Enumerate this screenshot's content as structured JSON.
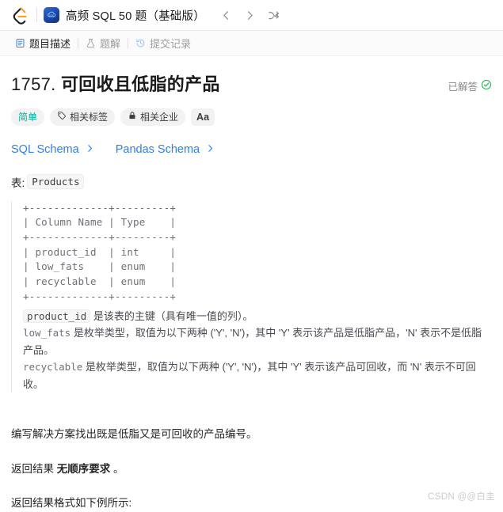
{
  "topbar": {
    "logo_icon": "leetcode-logo-icon",
    "app_icon": "study-plan-cloud-icon",
    "study_plan_title": "高频 SQL 50 题（基础版）",
    "prev_label": "‹",
    "next_label": "›",
    "shuffle_label": "⤫"
  },
  "tabs": [
    {
      "label": "题目描述",
      "icon": "description-icon",
      "active": true
    },
    {
      "label": "题解",
      "icon": "flask-icon",
      "active": false
    },
    {
      "label": "提交记录",
      "icon": "history-icon",
      "active": false
    }
  ],
  "question": {
    "number": "1757.",
    "title": "可回收且低脂的产品",
    "status_label": "已解答",
    "status_icon": "check-circle-icon",
    "difficulty": "简单",
    "difficulty_color": "#00af9b",
    "tags_label": "相关标签",
    "companies_label": "相关企业",
    "font_button_label": "Aa"
  },
  "schema_links": [
    {
      "label": "SQL Schema",
      "chevron": "›"
    },
    {
      "label": "Pandas Schema",
      "chevron": "›"
    }
  ],
  "table_section": {
    "prefix": "表:",
    "table_name": "Products",
    "ascii": "+-------------+---------+\n| Column Name | Type    |\n+-------------+---------+\n| product_id  | int     |\n| low_fats    | enum    |\n| recyclable  | enum    |\n+-------------+---------+",
    "notes": [
      {
        "code": "product_id",
        "text": " 是该表的主键（具有唯一值的列）。"
      },
      {
        "code": "low_fats",
        "text": " 是枚举类型，取值为以下两种 ('Y', 'N')，其中 'Y' 表示该产品是低脂产品，'N' 表示不是低脂产品。"
      },
      {
        "code": "recyclable",
        "text": " 是枚举类型，取值为以下两种 ('Y', 'N')，其中 'Y' 表示该产品可回收，而 'N' 表示不可回收。"
      }
    ]
  },
  "body": {
    "para1": "编写解决方案找出既是低脂又是可回收的产品编号。",
    "para2_prefix": "返回结果 ",
    "para2_bold": "无顺序要求",
    "para2_suffix": " 。",
    "para3": "返回结果格式如下例所示:"
  },
  "watermark": "CSDN @@白圭"
}
